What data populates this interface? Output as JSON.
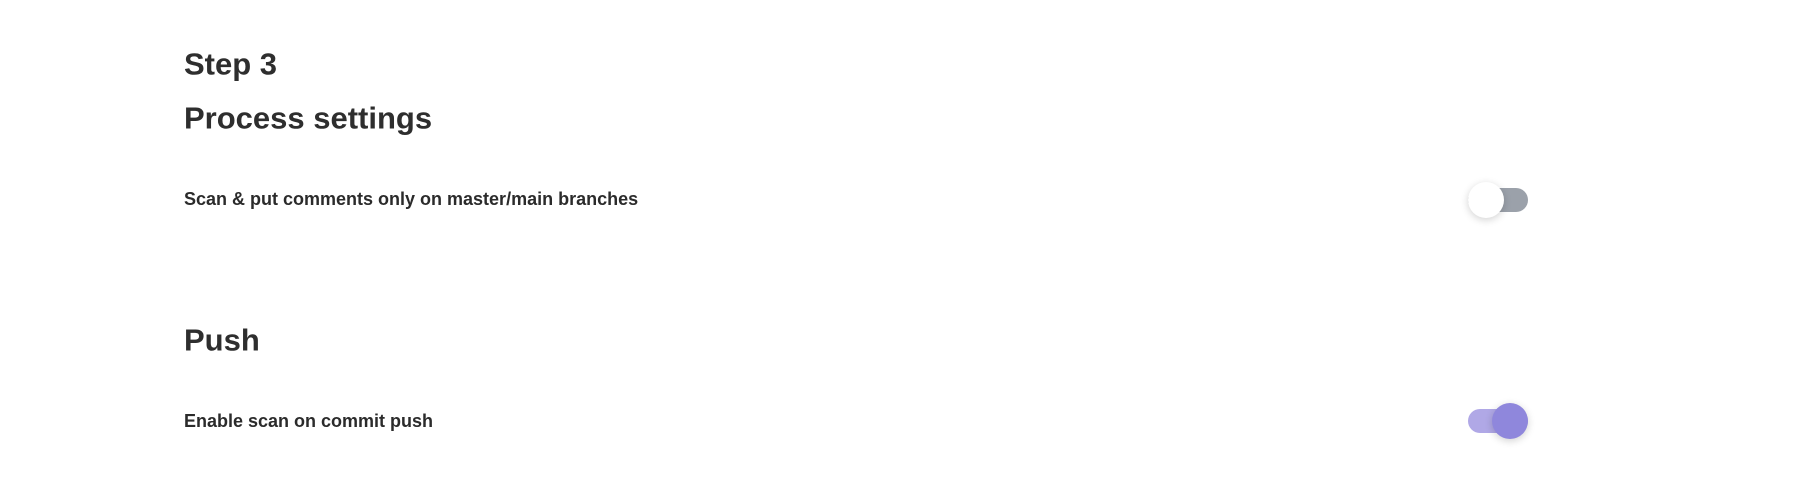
{
  "step_label": "Step 3",
  "sections": [
    {
      "title": "Process settings",
      "setting": {
        "label": "Scan & put comments only on master/main branches",
        "enabled": false
      }
    },
    {
      "title": "Push",
      "setting": {
        "label": "Enable scan on commit push",
        "enabled": true
      }
    }
  ],
  "colors": {
    "accent": "#8f87dc",
    "accent_track": "#b0a8e6",
    "off_track": "#9ba1aa"
  }
}
